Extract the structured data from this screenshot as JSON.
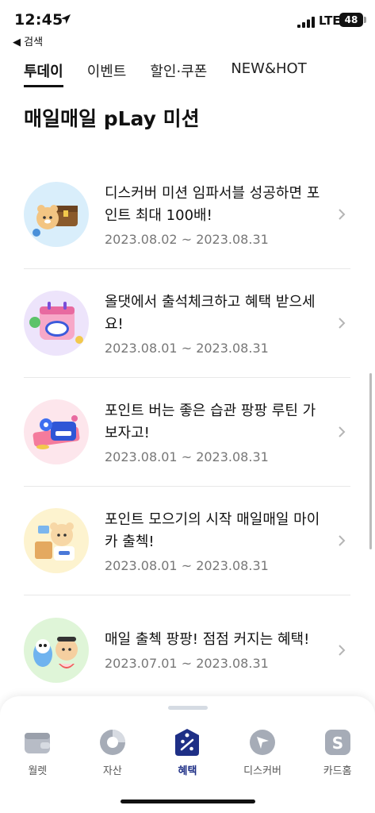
{
  "status": {
    "time": "12:45",
    "back_label": "◀ 검색",
    "network": "LTE",
    "battery": "48"
  },
  "tabs": [
    {
      "label": "투데이",
      "active": true
    },
    {
      "label": "이벤트",
      "active": false
    },
    {
      "label": "할인·쿠폰",
      "active": false
    },
    {
      "label": "NEW&HOT",
      "active": false
    }
  ],
  "page_title": "매일매일 pLay 미션",
  "events": [
    {
      "title": "디스커버 미션 임파서블 성공하면 포인트 최대 100배!",
      "date": "2023.08.02 ~ 2023.08.31",
      "icon": "treasure-chest-icon",
      "bg": "#d9eefb"
    },
    {
      "title": "올댓에서 출석체크하고 혜택 받으세요!",
      "date": "2023.08.01 ~ 2023.08.31",
      "icon": "attendance-calendar-icon",
      "bg": "#ede4fb"
    },
    {
      "title": "포인트 버는 좋은 습관 팡팡 루틴 가보자고!",
      "date": "2023.08.01 ~ 2023.08.31",
      "icon": "ping-pay-icon",
      "bg": "#fde6ec"
    },
    {
      "title": "포인트 모으기의 시작 매일매일 마이카 출첵!",
      "date": "2023.08.01 ~ 2023.08.31",
      "icon": "mycar-bear-icon",
      "bg": "#fdf3cf"
    },
    {
      "title": "매일 출첵 팡팡! 점점 커지는 혜택!",
      "date": "2023.07.01 ~ 2023.08.31",
      "icon": "characters-icon",
      "bg": "#dff5d8"
    }
  ],
  "nav": [
    {
      "label": "월렛",
      "icon": "wallet-icon",
      "active": false
    },
    {
      "label": "자산",
      "icon": "pie-chart-icon",
      "active": false
    },
    {
      "label": "혜택",
      "icon": "benefit-tag-icon",
      "active": true
    },
    {
      "label": "디스커버",
      "icon": "compass-icon",
      "active": false
    },
    {
      "label": "카드홈",
      "icon": "card-home-icon",
      "active": false
    }
  ],
  "colors": {
    "active_nav": "#1e2f86",
    "date_text": "#777777",
    "divider": "#e8e8e8"
  }
}
